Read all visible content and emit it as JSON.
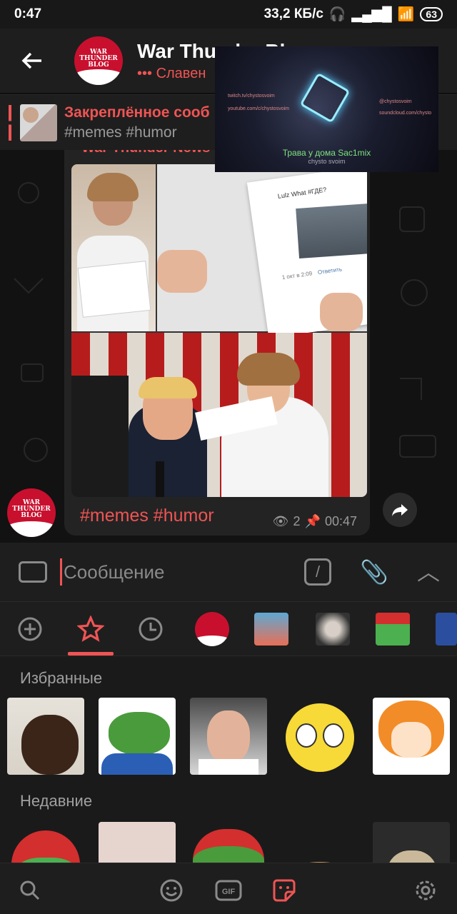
{
  "status": {
    "time": "0:47",
    "speed": "33,2 КБ/с",
    "battery": "63"
  },
  "header": {
    "title": "War Thunder Blog",
    "subtitle": "••• Славен",
    "avatar_text": "WAR THUNDER BLOG"
  },
  "pinned": {
    "title": "Закреплённое сооб",
    "tags": "#memes #humor"
  },
  "message": {
    "author": "War Thunder News",
    "tags": "#memes #humor",
    "views": "2",
    "time": "00:47",
    "image_text": {
      "top_label": "Lulz What #ГДЕ?",
      "date": "1 окт в 2:09",
      "reply": "Ответить"
    }
  },
  "pip": {
    "caption": "Трава у дома Sac1mix",
    "sub": "chysto svoim",
    "link1": "twitch.tv/chystosvoim",
    "link2": "youtube.com/c/chystosvoim",
    "link3": "@chystosvoim",
    "link4": "soundcloud.com/chysto"
  },
  "input": {
    "placeholder": "Сообщение",
    "slash": "/"
  },
  "sections": {
    "favorites": "Избранные",
    "recent": "Недавние"
  },
  "sticker_tabs": [
    "add",
    "favorites",
    "recent",
    "war-thunder-blog",
    "fish",
    "dog",
    "pepe-santa",
    "partial"
  ],
  "colors": {
    "accent": "#f05454",
    "bg": "#1e1e1e",
    "muted": "#8a8a8a"
  }
}
